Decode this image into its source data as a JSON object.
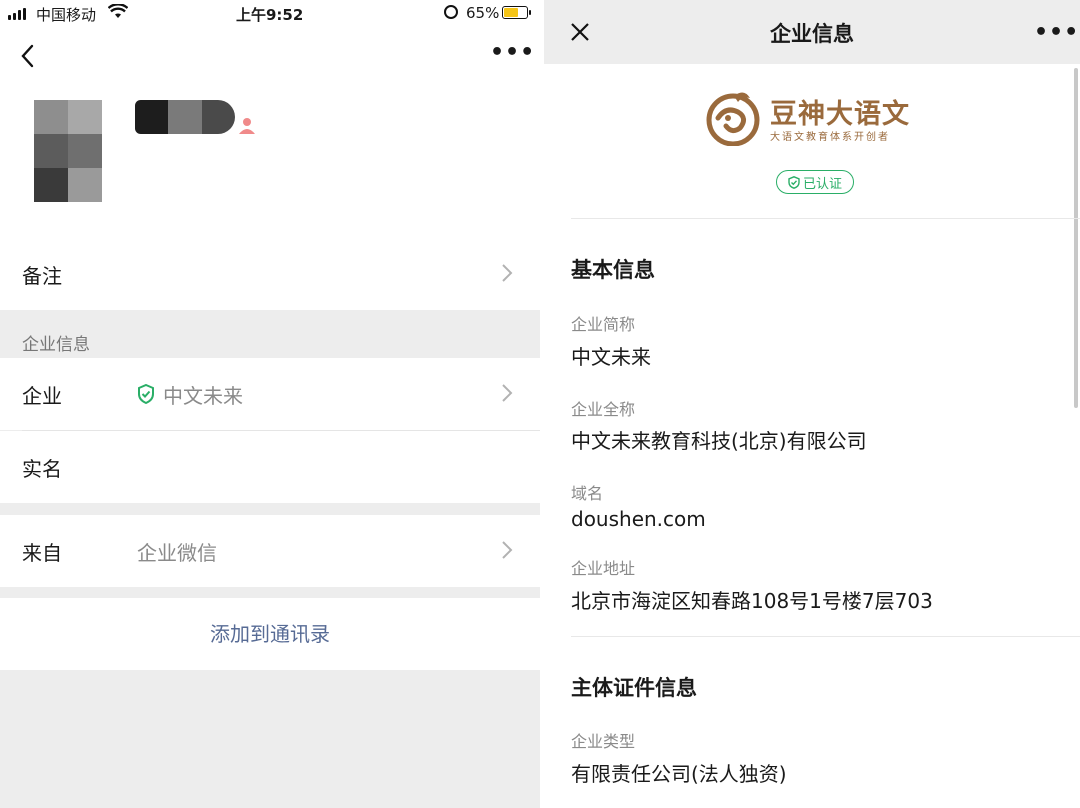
{
  "left": {
    "status": {
      "carrier": "中国移动",
      "time": "上午9:52",
      "battery": "65%"
    },
    "rows": {
      "remark": {
        "label": "备注"
      },
      "company": {
        "label": "企业",
        "value": "中文未来"
      },
      "realname": {
        "label": "实名"
      },
      "source": {
        "label": "来自",
        "value": "企业微信"
      }
    },
    "section_label": "企业信息",
    "add_contact": "添加到通讯录"
  },
  "right": {
    "nav_title": "企业信息",
    "logo": {
      "name": "豆神大语文",
      "tagline": "大语文教育体系开创者"
    },
    "badge": "已认证",
    "basic": {
      "heading": "基本信息",
      "fields": [
        {
          "label": "企业简称",
          "value": "中文未来"
        },
        {
          "label": "企业全称",
          "value": "中文未来教育科技(北京)有限公司"
        },
        {
          "label": "域名",
          "value": "doushen.com"
        },
        {
          "label": "企业地址",
          "value": "北京市海淀区知春路108号1号楼7层703"
        }
      ]
    },
    "license": {
      "heading": "主体证件信息",
      "fields": [
        {
          "label": "企业类型",
          "value": "有限责任公司(法人独资)"
        }
      ]
    }
  },
  "colors": {
    "link": "#576b95",
    "verified": "#2aae67",
    "logo_brown": "#9a6a3c"
  }
}
